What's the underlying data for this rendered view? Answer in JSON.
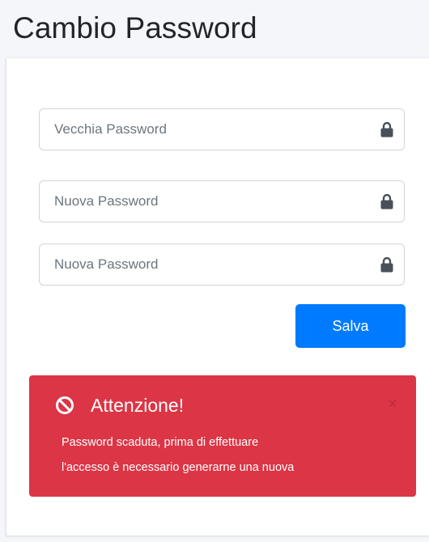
{
  "page": {
    "title": "Cambio Password"
  },
  "form": {
    "old_password": {
      "placeholder": "Vecchia Password",
      "value": "",
      "icon": "lock-icon"
    },
    "new_password": {
      "placeholder": "Nuova Password",
      "value": "",
      "icon": "lock-icon"
    },
    "confirm_password": {
      "placeholder": "Nuova Password",
      "value": "",
      "icon": "lock-icon"
    },
    "submit_label": "Salva"
  },
  "alert": {
    "icon": "ban-icon",
    "title": "Attenzione!",
    "close_label": "×",
    "line1": "Password scaduta, prima di effettuare",
    "line2": "l'accesso è necessario generarne una nuova"
  },
  "colors": {
    "primary": "#007bff",
    "danger": "#dc3545",
    "background": "#f4f6f9",
    "card": "#ffffff",
    "icon": "#495057"
  }
}
